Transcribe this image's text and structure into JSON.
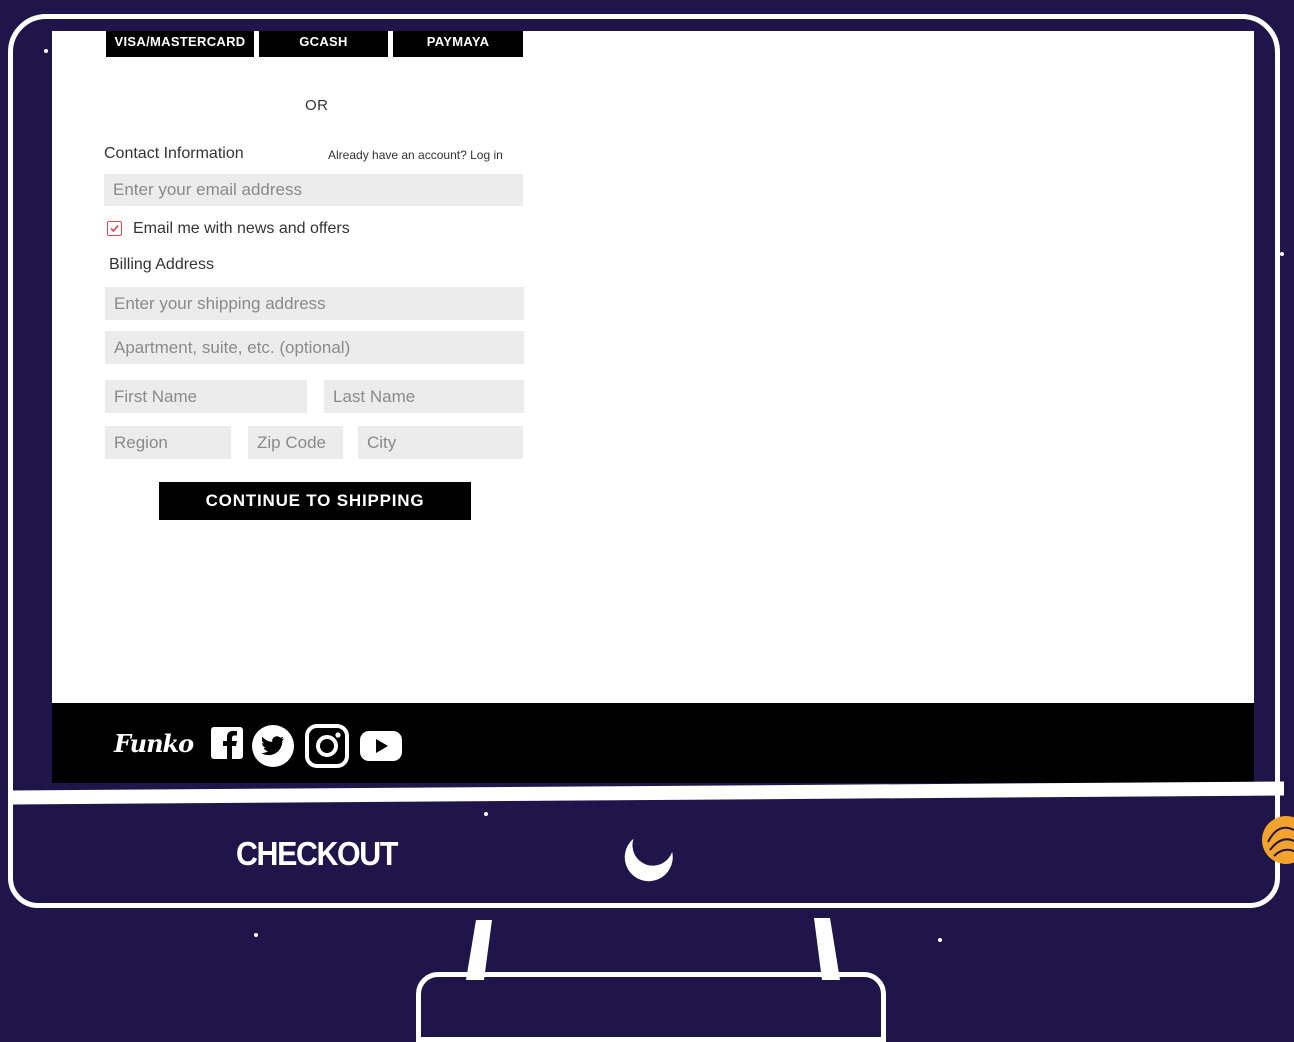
{
  "payment": {
    "methods": [
      "VISA/MASTERCARD",
      "GCASH",
      "PAYMAYA"
    ],
    "separator": "OR"
  },
  "contact": {
    "label": "Contact Information",
    "login_link": "Already have an account? Log in",
    "email_placeholder": "Enter your email address",
    "newsletter_label": "Email me with news and offers",
    "newsletter_checked": true
  },
  "billing": {
    "label": "Billing Address",
    "address_placeholder": "Enter your shipping address",
    "apartment_placeholder": "Apartment, suite, etc. (optional)",
    "first_name_placeholder": "First Name",
    "last_name_placeholder": "Last Name",
    "region_placeholder": "Region",
    "zip_placeholder": "Zip Code",
    "city_placeholder": "City"
  },
  "continue_label": "CONTINUE TO SHIPPING",
  "footer": {
    "brand": "Funko",
    "social_icons": [
      "facebook-icon",
      "twitter-icon",
      "instagram-icon",
      "youtube-icon"
    ]
  },
  "caption": {
    "title": "CHECKOUT"
  },
  "colors": {
    "background": "#20154a",
    "checkbox_accent": "#e0485a",
    "field_bg": "#ececec"
  }
}
